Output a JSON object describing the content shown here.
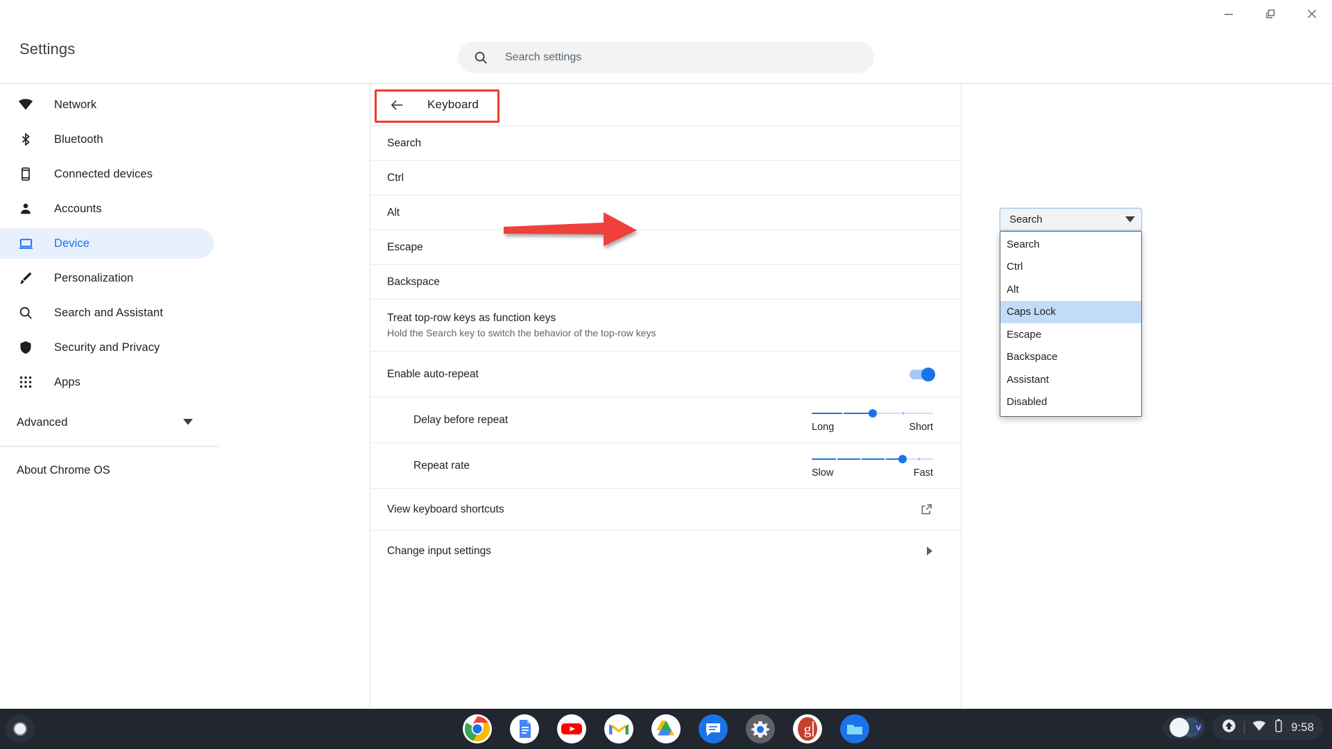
{
  "window": {
    "minimize_label": "Minimize",
    "restore_label": "Restore",
    "close_label": "Close"
  },
  "header": {
    "title": "Settings",
    "search_placeholder": "Search settings",
    "search_icon": "search-icon"
  },
  "sidebar": {
    "items": [
      {
        "label": "Network",
        "icon": "wifi-icon",
        "selected": false
      },
      {
        "label": "Bluetooth",
        "icon": "bluetooth-icon",
        "selected": false
      },
      {
        "label": "Connected devices",
        "icon": "phone-icon",
        "selected": false
      },
      {
        "label": "Accounts",
        "icon": "person-icon",
        "selected": false
      },
      {
        "label": "Device",
        "icon": "laptop-icon",
        "selected": true
      },
      {
        "label": "Personalization",
        "icon": "brush-icon",
        "selected": false
      },
      {
        "label": "Search and Assistant",
        "icon": "search-icon",
        "selected": false
      },
      {
        "label": "Security and Privacy",
        "icon": "shield-icon",
        "selected": false
      },
      {
        "label": "Apps",
        "icon": "grid-icon",
        "selected": false
      }
    ],
    "advanced_label": "Advanced",
    "advanced_icon": "chevron-down-icon",
    "about_label": "About Chrome OS"
  },
  "detail": {
    "back_icon": "back-arrow-icon",
    "title": "Keyboard",
    "rows": {
      "search": "Search",
      "ctrl": "Ctrl",
      "alt": "Alt",
      "escape": "Escape",
      "backspace": "Backspace",
      "toprow_title": "Treat top-row keys as function keys",
      "toprow_sub": "Hold the Search key to switch the behavior of the top-row keys",
      "auto_repeat": "Enable auto-repeat",
      "delay_before_repeat": "Delay before repeat",
      "repeat_rate": "Repeat rate",
      "view_shortcuts": "View keyboard shortcuts",
      "change_input": "Change input settings"
    },
    "select": {
      "value": "Search",
      "caret_icon": "caret-down-icon",
      "options": [
        "Search",
        "Ctrl",
        "Alt",
        "Caps Lock",
        "Escape",
        "Backspace",
        "Assistant",
        "Disabled"
      ],
      "highlighted_option": "Caps Lock"
    },
    "auto_repeat_on": true,
    "delay_slider": {
      "min_label": "Long",
      "max_label": "Short",
      "percent": 50
    },
    "rate_slider": {
      "min_label": "Slow",
      "max_label": "Fast",
      "percent": 75
    },
    "shortcut_icon": "external-link-icon",
    "input_icon": "chevron-right-icon"
  },
  "annotations": {
    "highlight_color": "#f4392e",
    "arrow_color": "#f0413a",
    "arrow_target": "Caps Lock"
  },
  "shelf": {
    "launcher_icon": "launcher-circle-icon",
    "apps": [
      {
        "name": "chrome-icon",
        "running": true
      },
      {
        "name": "docs-icon",
        "running": true
      },
      {
        "name": "youtube-icon",
        "running": false
      },
      {
        "name": "gmail-icon",
        "running": false
      },
      {
        "name": "drive-icon",
        "running": false
      },
      {
        "name": "messages-icon",
        "running": false
      },
      {
        "name": "settings-icon",
        "running": true
      },
      {
        "name": "google-g-icon",
        "running": false
      },
      {
        "name": "files-icon",
        "running": true
      }
    ],
    "tray": {
      "avatar_icon": "avatar-icon",
      "update_icon": "update-arrow-icon",
      "wifi_icon": "wifi-icon",
      "battery_icon": "battery-icon",
      "time": "9:58"
    }
  }
}
